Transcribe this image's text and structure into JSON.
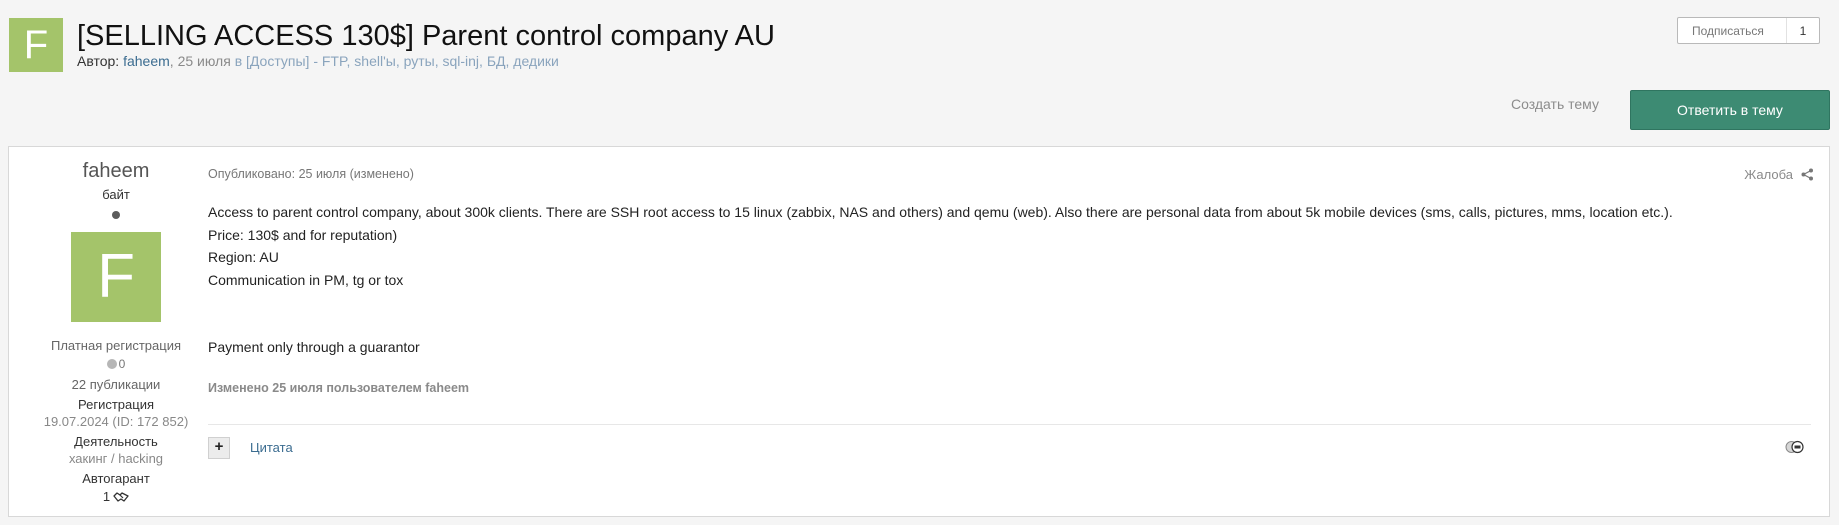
{
  "header": {
    "avatar_letter": "F",
    "title": "[SELLING ACCESS 130$] Parent control company AU",
    "meta": {
      "author_label": "Автор:",
      "author": "faheem",
      "date": "25 июля",
      "category": "в [Доступы] - FTP, shell'ы, руты, sql-inj, БД, дедики"
    },
    "follow": {
      "label": "Подписаться",
      "count": "1"
    }
  },
  "actions": {
    "create_topic": "Создать тему",
    "reply": "Ответить в тему"
  },
  "post": {
    "author": {
      "name": "faheem",
      "rank": "байт",
      "avatar_letter": "F",
      "group": "Платная регистрация",
      "reputation": "0",
      "posts": "22 публикации",
      "registration_label": "Регистрация",
      "registration_value": "19.07.2024 (ID: 172 852)",
      "activity_label": "Деятельность",
      "activity_value": "хакинг / hacking",
      "guarantee_label": "Автогарант",
      "guarantee_value": "1"
    },
    "published": "Опубликовано: 25 июля (изменено)",
    "report": "Жалоба",
    "body": {
      "line1": "Access to parent control company, about 300k clients. There are SSH root access to 15 linux (zabbix, NAS and others) and qemu (web). Also there are personal data from about 5k mobile devices (sms, calls, pictures, mms, location etc.).",
      "line2": "Price: 130$ and for reputation)",
      "line3": "Region: AU",
      "line4": "Communication in PM, tg or tox",
      "line5": "Payment only through a guarantor"
    },
    "edited": "Изменено 25 июля пользователем faheem",
    "footer": {
      "plus": "+",
      "quote": "Цитата"
    }
  },
  "colors": {
    "avatar_bg": "#a4c46a",
    "reply_button_bg": "#3d8b73",
    "link": "#3b6c90"
  }
}
